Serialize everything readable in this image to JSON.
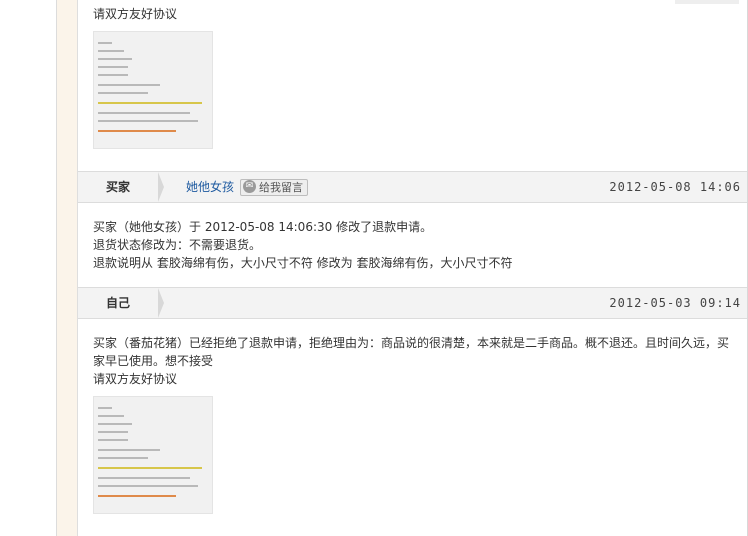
{
  "entries": [
    {
      "text_lines": [
        "请双方友好协议"
      ]
    },
    {
      "role": "买家",
      "buyer_name": "她他女孩",
      "message_button": "给我留言",
      "timestamp": "2012-05-08 14:06",
      "text_lines": [
        "买家（她他女孩）于 2012-05-08 14:06:30 修改了退款申请。",
        "退货状态修改为：不需要退货。",
        "退款说明从 套胶海绵有伤，大小尺寸不符 修改为 套胶海绵有伤，大小尺寸不符"
      ]
    },
    {
      "role": "自己",
      "timestamp": "2012-05-03 09:14",
      "text_lines": [
        "买家（番茄花猪）已经拒绝了退款申请，拒绝理由为：商品说的很清楚，本来就是二手商品。概不退还。且时间久远，买",
        "家早已使用。想不接受",
        "请双方友好协议"
      ]
    }
  ]
}
